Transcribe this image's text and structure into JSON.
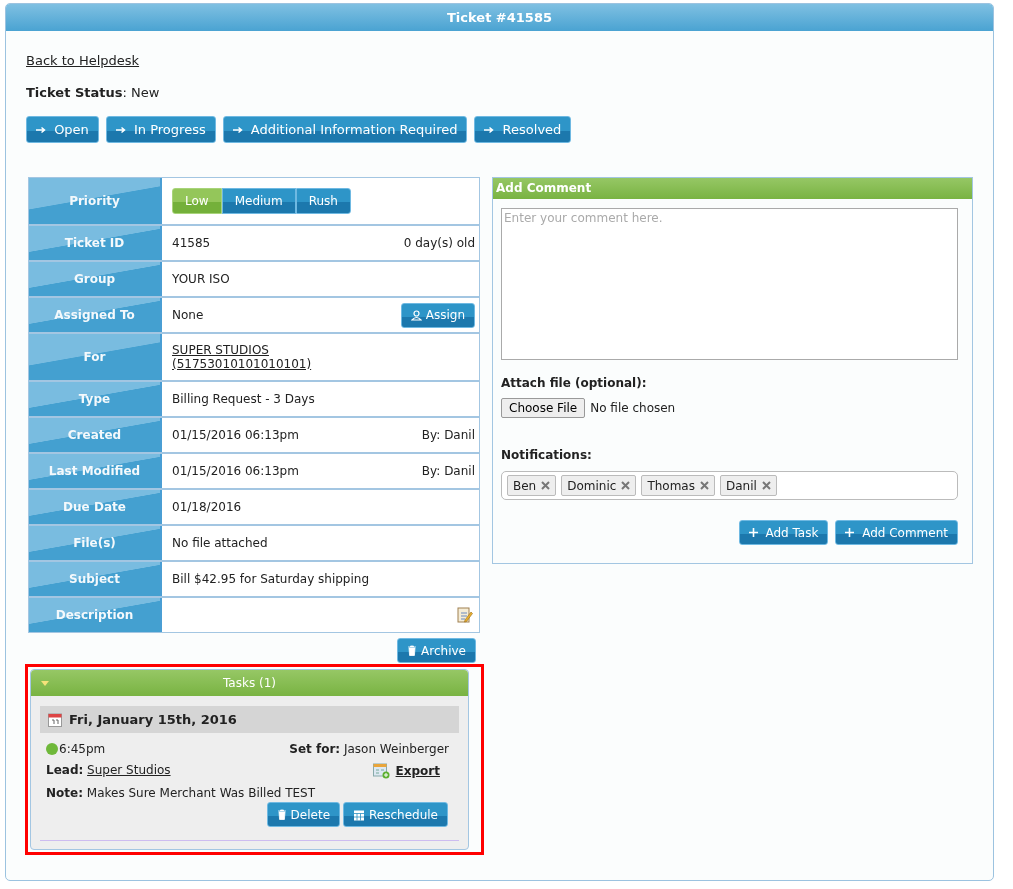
{
  "window": {
    "title": "Ticket #41585"
  },
  "back_link": "Back to Helpdesk",
  "status": "**Ticket Status**: New",
  "status_buttons": [
    "Open",
    "In Progress",
    "Additional Information Required",
    "Resolved"
  ],
  "details": [
    {
      "kind": "priority",
      "label": "Priority",
      "options": [
        {
          "label": "Low",
          "selected": true
        },
        {
          "label": "Medium",
          "selected": false
        },
        {
          "label": "Rush",
          "selected": false
        }
      ]
    },
    {
      "kind": "text",
      "label": "Ticket ID",
      "value": "41585",
      "extra": "0 day(s) old"
    },
    {
      "kind": "text",
      "label": "Group",
      "value": "YOUR ISO"
    },
    {
      "kind": "assign",
      "label": "Assigned To",
      "value": "None",
      "button": "Assign"
    },
    {
      "kind": "link",
      "label": "For",
      "value": "SUPER STUDIOS (51753010101010101)"
    },
    {
      "kind": "text",
      "label": "Type",
      "value": "Billing Request - 3 Days"
    },
    {
      "kind": "text",
      "label": "Created",
      "value": "01/15/2016 06:13pm",
      "extra": "By: Danil"
    },
    {
      "kind": "text",
      "label": "Last Modified",
      "value": "01/15/2016 06:13pm",
      "extra": "By: Danil"
    },
    {
      "kind": "text",
      "label": "Due Date",
      "value": "01/18/2016"
    },
    {
      "kind": "text",
      "label": "File(s)",
      "value": "No file attached"
    },
    {
      "kind": "text",
      "label": "Subject",
      "value": "Bill $42.95 for Saturday shipping"
    },
    {
      "kind": "edit",
      "label": "Description"
    }
  ],
  "archive_button": "Archive",
  "tasks": {
    "title": "Tasks (1)",
    "expanded": true,
    "date": "Fri, January 15th, 2016",
    "items": [
      {
        "time": "6:45pm",
        "color": "#6fb83a",
        "set_for_label": "Set for:",
        "set_for": "Jason Weinberger",
        "lead_label": "Lead:",
        "lead": "Super Studios",
        "export": "Export",
        "note_label": "Note:",
        "note": "Makes Sure Merchant Was Billed TEST",
        "buttons": [
          "Delete",
          "Reschedule"
        ]
      }
    ]
  },
  "comment": {
    "title": "Add Comment",
    "placeholder": "Enter your comment here.",
    "attach_label": "Attach file (optional):",
    "file_button": "Choose File",
    "file_status": "No file chosen",
    "notifications_label": "Notifications:",
    "recipients": [
      "Ben",
      "Dominic",
      "Thomas",
      "Danil"
    ],
    "buttons": [
      "Add Task",
      "Add Comment"
    ]
  }
}
